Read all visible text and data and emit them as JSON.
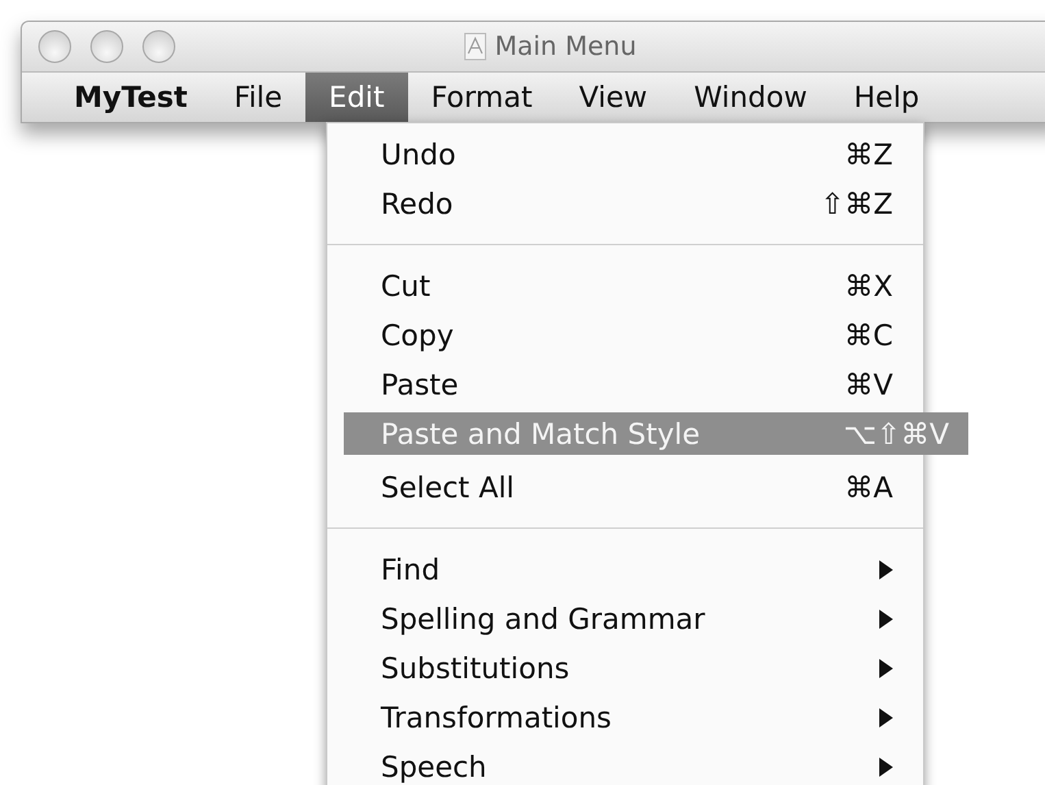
{
  "window": {
    "title": "Main Menu"
  },
  "menu_bar": [
    {
      "label": "MyTest",
      "kind": "app",
      "selected": false
    },
    {
      "label": "File",
      "kind": "menu",
      "selected": false
    },
    {
      "label": "Edit",
      "kind": "menu",
      "selected": true
    },
    {
      "label": "Format",
      "kind": "menu",
      "selected": false
    },
    {
      "label": "View",
      "kind": "menu",
      "selected": false
    },
    {
      "label": "Window",
      "kind": "menu",
      "selected": false
    },
    {
      "label": "Help",
      "kind": "menu",
      "selected": false
    }
  ],
  "edit_menu": [
    {
      "kind": "item",
      "label": "Undo",
      "shortcut": "⌘Z"
    },
    {
      "kind": "item",
      "label": "Redo",
      "shortcut": "⇧⌘Z"
    },
    {
      "kind": "separator"
    },
    {
      "kind": "item",
      "label": "Cut",
      "shortcut": "⌘X"
    },
    {
      "kind": "item",
      "label": "Copy",
      "shortcut": "⌘C"
    },
    {
      "kind": "item",
      "label": "Paste",
      "shortcut": "⌘V"
    },
    {
      "kind": "dragged",
      "label": "Paste and Match Style",
      "shortcut": "⌥⇧⌘V"
    },
    {
      "kind": "item",
      "label": "Select All",
      "shortcut": "⌘A"
    },
    {
      "kind": "separator"
    },
    {
      "kind": "submenu",
      "label": "Find"
    },
    {
      "kind": "submenu",
      "label": "Spelling and Grammar"
    },
    {
      "kind": "submenu",
      "label": "Substitutions"
    },
    {
      "kind": "submenu",
      "label": "Transformations"
    },
    {
      "kind": "submenu",
      "label": "Speech"
    }
  ]
}
